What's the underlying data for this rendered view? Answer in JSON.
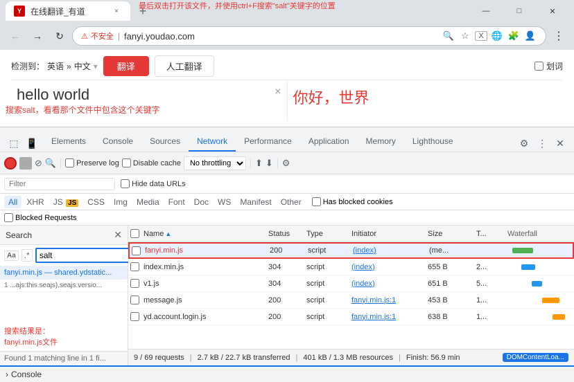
{
  "window": {
    "title": "在线翻译_有道",
    "favicon": "Y",
    "url": "fanyi.youdao.com",
    "security_label": "不安全"
  },
  "tabs": {
    "active_label": "在线翻译_有道",
    "new_tab_icon": "+"
  },
  "nav": {
    "back": "←",
    "forward": "→",
    "refresh": "↻"
  },
  "website": {
    "detect_label": "检测到：",
    "lang_from": "英语",
    "lang_arrow": "»",
    "lang_to": "中文",
    "translate_btn": "翻译",
    "human_btn": "人工翻译",
    "vocab_label": "划词",
    "input_text": "hello world",
    "output_text": "你好，世界",
    "clear_icon": "×"
  },
  "devtools": {
    "annotation_top": "搜索salt，看看那个文件中包含这个关键字",
    "annotation_mid": "最后双击打开该文件，并使用ctrl+F搜索\"salt\"关键字的位置",
    "annotation_result": "搜索结果是：\nfanyi.min.js文件",
    "tabs": [
      {
        "label": "Elements",
        "active": false
      },
      {
        "label": "Console",
        "active": false
      },
      {
        "label": "Sources",
        "active": false
      },
      {
        "label": "Network",
        "active": true
      },
      {
        "label": "Performance",
        "active": false
      },
      {
        "label": "Application",
        "active": false
      },
      {
        "label": "Memory",
        "active": false
      },
      {
        "label": "Lighthouse",
        "active": false
      }
    ],
    "toolbar": {
      "preserve_log": "Preserve log",
      "disable_cache": "Disable cache",
      "throttle": "No throttling",
      "throttle_arrow": "▾"
    },
    "filterbar": {
      "placeholder": "Filter",
      "hide_data": "Hide data URLs",
      "types": [
        "All",
        "XHR",
        "JS",
        "CSS",
        "Img",
        "Media",
        "Font",
        "Doc",
        "WS",
        "Manifest",
        "Other"
      ],
      "blocked_cookies": "Has blocked cookies",
      "blocked_requests": "Blocked Requests"
    },
    "search": {
      "header": "Search",
      "aa_label": "Aa",
      "dot_label": ".*",
      "input_value": "salt",
      "count": "Found 1 matching line in 1 fi..."
    },
    "table": {
      "headers": [
        "",
        "Name",
        "Status",
        "Type",
        "Initiator",
        "Size",
        "T...",
        "Waterfall"
      ],
      "rows": [
        {
          "selected": true,
          "highlighted": true,
          "name": "fanyi.min.js",
          "status": "200",
          "type": "script",
          "initiator": "(index)",
          "size": "(me...",
          "time": "",
          "waterfall_w": 30,
          "waterfall_color": "green"
        },
        {
          "selected": false,
          "highlighted": false,
          "name": "index.min.js",
          "status": "304",
          "type": "script",
          "initiator": "(index)",
          "size": "655 B",
          "time": "2...",
          "waterfall_w": 20,
          "waterfall_color": "blue"
        },
        {
          "selected": false,
          "highlighted": false,
          "name": "v1.js",
          "status": "304",
          "type": "script",
          "initiator": "(index)",
          "size": "651 B",
          "time": "5...",
          "waterfall_w": 15,
          "waterfall_color": "blue"
        },
        {
          "selected": false,
          "highlighted": false,
          "name": "message.js",
          "status": "200",
          "type": "script",
          "initiator": "fanyi.min.js:1",
          "size": "453 B",
          "time": "1...",
          "waterfall_w": 25,
          "waterfall_color": "orange"
        },
        {
          "selected": false,
          "highlighted": false,
          "name": "yd.account.login.js",
          "status": "200",
          "type": "script",
          "initiator": "fanyi.min.js:1",
          "size": "638 B",
          "time": "1...",
          "waterfall_w": 18,
          "waterfall_color": "orange"
        }
      ]
    },
    "statusbar": {
      "requests": "9 / 69 requests",
      "transferred": "2.7 kB / 22.7 kB transferred",
      "resources": "401 kB / 1.3 MB resources",
      "finish": "Finish: 56.9 min",
      "domcontent": "DOMContentLoa..."
    },
    "search_results": [
      {
        "name": "fanyi.min.js",
        "detail": "— shared.ydstatic..."
      },
      {
        "name": "1",
        "detail": "...ajs:this.seajs),seajs.versio..."
      }
    ]
  },
  "console_bar": {
    "label": "Console"
  }
}
